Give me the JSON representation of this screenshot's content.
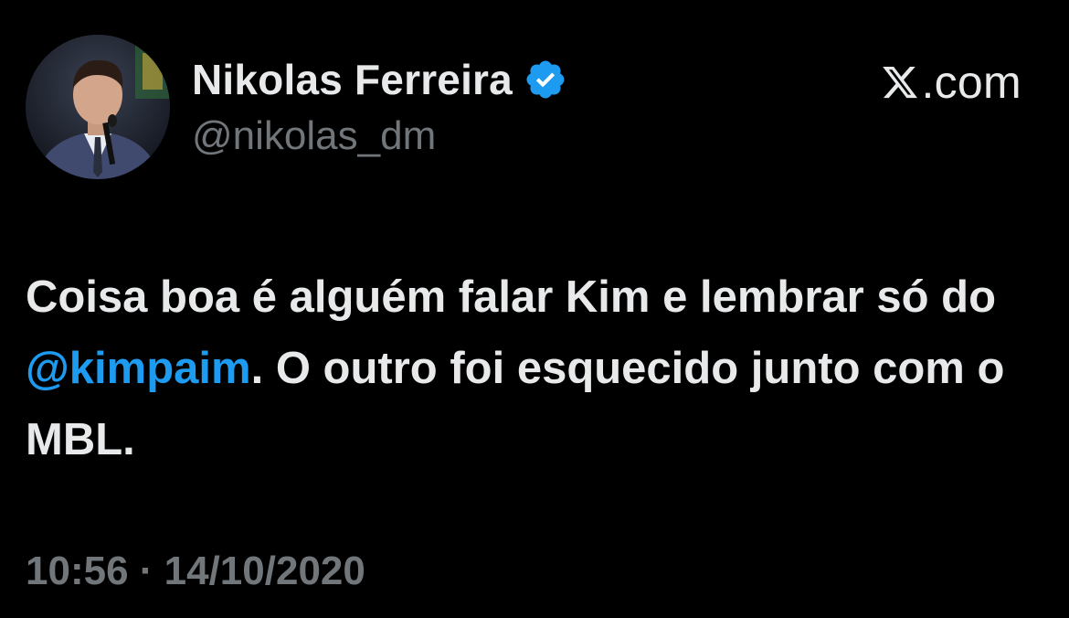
{
  "author": {
    "display_name": "Nikolas Ferreira",
    "handle": "@nikolas_dm",
    "verified_icon": "verified-badge-icon",
    "avatar": "profile-photo"
  },
  "brand": {
    "logo_icon": "x-logo-icon",
    "text": ".com"
  },
  "tweet": {
    "text_before_mention": "Coisa boa é alguém falar Kim e lembrar só do ",
    "mention": "@kimpaim",
    "text_after_mention": ". O outro foi esquecido junto com o MBL."
  },
  "meta": {
    "timestamp": "10:56 · 14/10/2020"
  },
  "colors": {
    "background": "#000000",
    "text_primary": "#e7e9ea",
    "text_secondary": "#71767b",
    "accent": "#1d9bf0"
  }
}
